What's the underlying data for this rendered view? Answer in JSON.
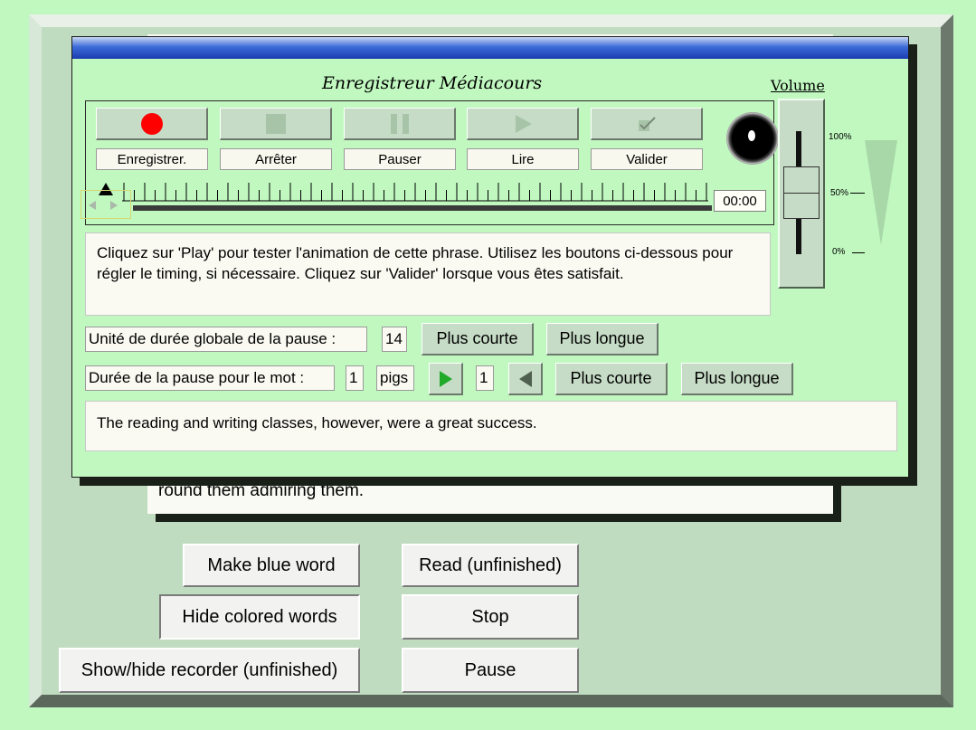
{
  "background_text": {
    "visible_line": "round them admiring them."
  },
  "buttons": {
    "make_blue_word": "Make blue word",
    "read": "Read (unfinished)",
    "hide_colored_words": "Hide colored words",
    "stop": "Stop",
    "show_hide_recorder": "Show/hide recorder (unfinished)",
    "pause": "Pause"
  },
  "recorder": {
    "title": "Enregistreur Médiacours",
    "volume_title": "Volume",
    "transport": [
      {
        "label": "Enregistrer.",
        "icon": "record-icon"
      },
      {
        "label": "Arrêter",
        "icon": "stop-icon"
      },
      {
        "label": "Pauser",
        "icon": "pause-icon"
      },
      {
        "label": "Lire",
        "icon": "play-icon"
      },
      {
        "label": "Valider",
        "icon": "checkmark-icon"
      }
    ],
    "time": "00:00",
    "volume_levels": {
      "top": "100%",
      "mid": "50%",
      "bottom": "0%"
    },
    "volume_level": 0.5,
    "instructions": "Cliquez sur 'Play' pour tester l'animation de cette phrase. Utilisez les boutons ci-dessous pour régler le timing, si nécessaire. Cliquez sur 'Valider' lorsque vous êtes satisfait.",
    "global_pause": {
      "label": "Unité de durée globale de la pause :",
      "value": "14",
      "shorter": "Plus courte",
      "longer": "Plus longue"
    },
    "word_pause": {
      "label": "Durée de la pause pour le mot :",
      "value": "1",
      "word": "pigs",
      "index": "1",
      "shorter": "Plus courte",
      "longer": "Plus longue"
    },
    "sentence": "The reading and writing classes, however, were a great success."
  },
  "colors": {
    "page_bg": "#c0f8c0",
    "frame": "#c0dcc0",
    "titlebar": "#1a3cb0",
    "record_red": "#ff0000",
    "play_green": "#1faa2a"
  }
}
